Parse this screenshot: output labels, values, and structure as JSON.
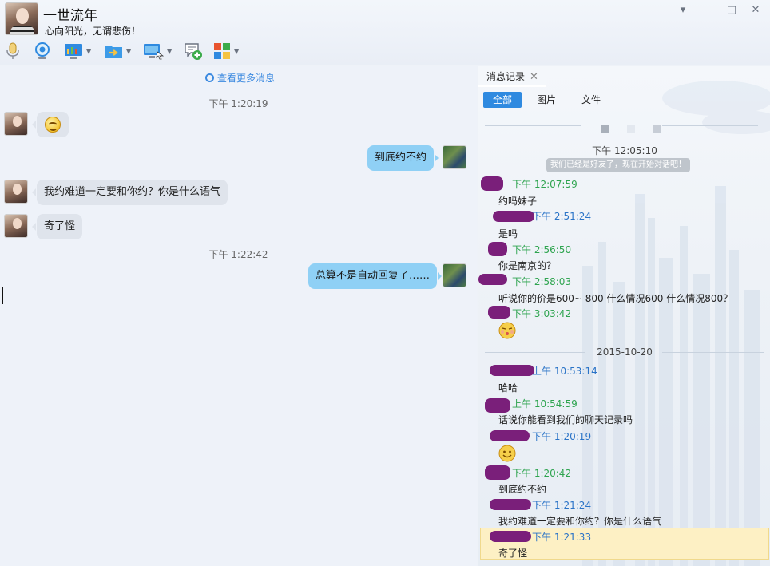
{
  "header": {
    "contact_name": "一世流年",
    "signature": "心向阳光，无谓悲伤！",
    "window_controls": [
      "chevron-down-icon",
      "minimize-icon",
      "maximize-icon",
      "close-icon"
    ],
    "toolbar_icons": [
      {
        "name": "voice-call-icon",
        "color": "#c9a23a",
        "dropdown": false
      },
      {
        "name": "video-call-icon",
        "color": "#2f8ae0",
        "dropdown": false
      },
      {
        "name": "screen-share-icon",
        "color": "#2f8ae0",
        "dropdown": true
      },
      {
        "name": "send-file-icon",
        "color": "#2f8ae0",
        "dropdown": true
      },
      {
        "name": "remote-desktop-icon",
        "color": "#2f8ae0",
        "dropdown": true
      },
      {
        "name": "create-discussion-icon",
        "color": "#3bab4a",
        "dropdown": false
      },
      {
        "name": "apps-grid-icon",
        "color": "#e8542f",
        "dropdown": true
      }
    ]
  },
  "chat": {
    "view_more": "查看更多消息",
    "messages": [
      {
        "type": "time",
        "text": "下午 1:20:19"
      },
      {
        "type": "in",
        "emoji": "smile-emoji"
      },
      {
        "type": "out",
        "text": "到底约不约"
      },
      {
        "type": "in",
        "text": "我约难道一定要和你约？你是什么语气"
      },
      {
        "type": "in",
        "text": "奇了怪"
      },
      {
        "type": "time",
        "text": "下午 1:22:42"
      },
      {
        "type": "out",
        "text": "总算不是自动回复了……"
      }
    ]
  },
  "history": {
    "tab_title": "消息记录",
    "filters": [
      "全部",
      "图片",
      "文件"
    ],
    "first_time": "下午 12:05:10",
    "system_note": "我们已经是好友了，现在开始对话吧！",
    "date_separator": "2015-10-20",
    "entries": [
      {
        "who": "them",
        "time": "下午 12:07:59",
        "text": "约吗妹子"
      },
      {
        "who": "me",
        "time": "下午 2:51:24",
        "text": "是吗"
      },
      {
        "who": "them",
        "time": "下午 2:56:50",
        "text": "你是南京的？"
      },
      {
        "who": "them",
        "time": "下午 2:58:03",
        "text": "听说你的价是600~ 800 什么情况600 什么情况800？"
      },
      {
        "who": "them",
        "time": "下午 3:03:42",
        "emoji": "kiss-emoji"
      },
      {
        "who": "me",
        "time": "上午 10:53:14",
        "text": "哈哈"
      },
      {
        "who": "them",
        "time": "上午 10:54:59",
        "text": "话说你能看到我们的聊天记录吗"
      },
      {
        "who": "me",
        "time": "下午 1:20:19",
        "emoji": "smile-emoji"
      },
      {
        "who": "them",
        "time": "下午 1:20:42",
        "text": "到底约不约"
      },
      {
        "who": "me",
        "time": "下午 1:21:24",
        "text": "我约难道一定要和你约？你是什么语气"
      },
      {
        "who": "me",
        "time": "下午 1:21:33",
        "text": "奇了怪"
      }
    ]
  }
}
